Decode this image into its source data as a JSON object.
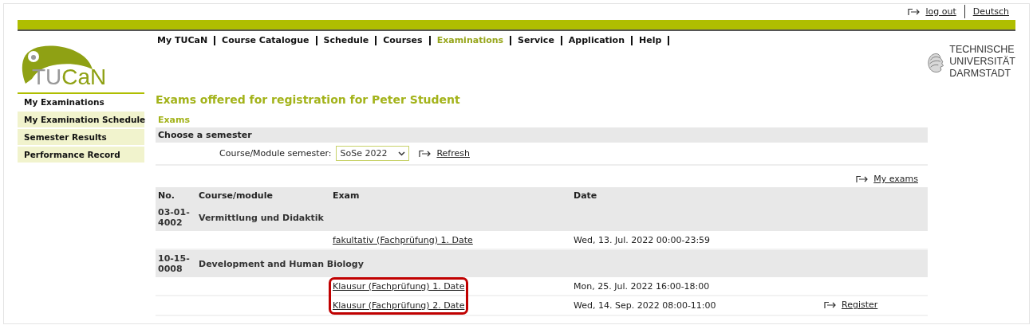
{
  "top_links": [
    {
      "label": "log out",
      "icon": true
    },
    {
      "label": "Deutsch",
      "icon": false
    }
  ],
  "logo": {
    "prefix": "TU",
    "suffix": "CaN"
  },
  "nav": [
    {
      "label": "My TUCaN",
      "selected": false
    },
    {
      "label": "Course Catalogue",
      "selected": false
    },
    {
      "label": "Schedule",
      "selected": false
    },
    {
      "label": "Courses",
      "selected": false
    },
    {
      "label": "Examinations",
      "selected": true
    },
    {
      "label": "Service",
      "selected": false
    },
    {
      "label": "Application",
      "selected": false
    },
    {
      "label": "Help",
      "selected": false
    }
  ],
  "university": {
    "lines": [
      "TECHNISCHE",
      "UNIVERSITÄT",
      "DARMSTADT"
    ]
  },
  "sidebar": {
    "items": [
      {
        "label": "My Examinations",
        "selected": true
      },
      {
        "label": "My Examination Schedule",
        "selected": false
      },
      {
        "label": "Semester Results",
        "selected": false
      },
      {
        "label": "Performance Record",
        "selected": false
      }
    ]
  },
  "page_title": "Exams offered for registration for Peter Student",
  "section_title": "Exams",
  "semester_box": {
    "heading": "Choose a semester",
    "label": "Course/Module semester:",
    "value": "SoSe 2022",
    "refresh": "Refresh"
  },
  "my_exams_link": "My exams",
  "table": {
    "columns": [
      "No.",
      "Course/module",
      "Exam",
      "Date"
    ],
    "rows": [
      {
        "kind": "module",
        "number": "03-01-4002",
        "name": "Vermittlung und Didaktik"
      },
      {
        "kind": "exam",
        "exam": "fakultativ (Fachprüfung) 1. Date",
        "date": "Wed, 13. Jul. 2022 00:00-23:59",
        "highlighted": false
      },
      {
        "kind": "module",
        "number": "10-15-0008",
        "name": "Development and Human Biology"
      },
      {
        "kind": "exam",
        "exam": "Klausur (Fachprüfung) 1. Date",
        "date": "Mon, 25. Jul. 2022 16:00-18:00",
        "highlighted": true
      },
      {
        "kind": "exam",
        "exam": "Klausur (Fachprüfung) 2. Date",
        "date": "Wed, 14. Sep. 2022 08:00-11:00",
        "highlighted": true,
        "action": "Register"
      }
    ]
  }
}
